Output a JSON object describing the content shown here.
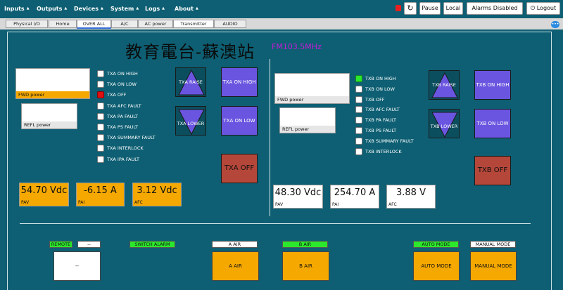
{
  "nav": {
    "items": [
      {
        "label": "Inputs"
      },
      {
        "label": "Outputs"
      },
      {
        "label": "Devices"
      },
      {
        "label": "System"
      },
      {
        "label": "Logs"
      },
      {
        "label": "About"
      }
    ],
    "pause_label": "Pause",
    "local_label": "Local",
    "alarms_label": "Alarms Disabled",
    "logout_label": "Logout",
    "caret_glyph": "▲",
    "refresh_glyph": "↻",
    "logout_glyph": "⏻"
  },
  "tabs": [
    {
      "label": "Physical I/O"
    },
    {
      "label": "Home"
    },
    {
      "label": "OVER ALL",
      "active": true
    },
    {
      "label": "A/C"
    },
    {
      "label": "AC power"
    },
    {
      "label": "Transmitter"
    },
    {
      "label": "AUDIO"
    }
  ],
  "station": {
    "title": "教育電台-蘇澳站",
    "freq": "FM103.5MHz"
  },
  "txa": {
    "fwd_label": "FWD power",
    "refl_label": "REFL power",
    "lamps": [
      {
        "label": "TXA ON HIGH",
        "state": "off"
      },
      {
        "label": "TXA ON LOW",
        "state": "off"
      },
      {
        "label": "TXA OFF",
        "state": "red"
      },
      {
        "label": "TXA AFC FAULT",
        "state": "off"
      },
      {
        "label": "TXA PA FAULT",
        "state": "off"
      },
      {
        "label": "TXA PS FAULT",
        "state": "off"
      },
      {
        "label": "TXA SUMMARY FAULT",
        "state": "off"
      },
      {
        "label": "TXA INTERLOCK",
        "state": "off"
      },
      {
        "label": "TXA IPA FAULT",
        "state": "off"
      }
    ],
    "raise_label": "TXA RAISE",
    "lower_label": "TXA LOWER",
    "on_high_label": "TXA ON HIGH",
    "on_low_label": "TXA ON LOW",
    "off_label": "TXA OFF",
    "pav_value": "54.70 Vdc",
    "pav_label": "PAV",
    "pai_value": "-6.15 A",
    "pai_label": "PAI",
    "afc_value": "3.12 Vdc",
    "afc_label": "AFC"
  },
  "txb": {
    "fwd_label": "FWD power",
    "refl_label": "REFL power",
    "lamps": [
      {
        "label": "TXB ON HIGH",
        "state": "green"
      },
      {
        "label": "TXB ON LOW",
        "state": "off"
      },
      {
        "label": "TXB OFF",
        "state": "off"
      },
      {
        "label": "TXB AFC FAULT",
        "state": "off"
      },
      {
        "label": "TXB PA FAULT",
        "state": "off"
      },
      {
        "label": "TXB PS FAULT",
        "state": "off"
      },
      {
        "label": "TXB SUMMARY FAULT",
        "state": "off"
      },
      {
        "label": "TXB INTERLOCK",
        "state": "off"
      }
    ],
    "raise_label": "TXB RAISE",
    "lower_label": "TXB LOWER",
    "on_high_label": "TXB ON HIGH",
    "on_low_label": "TXB ON LOW",
    "off_label": "TXB OFF",
    "pav_value": "48.30 Vdc",
    "pav_label": "PAV",
    "pai_value": "254.70 A",
    "pai_label": "PAI",
    "afc_value": "3.88 V",
    "afc_label": "AFC"
  },
  "bottom": {
    "remote_label": "REMOTE",
    "dash_label": "--",
    "dash_big_label": "--",
    "switch_alarm_label": "SWITCH ALARM",
    "a_air_tag": "A AIR",
    "a_air_btn": "A AIR",
    "b_air_tag": "B AIR",
    "b_air_btn": "B AIR",
    "auto_tag": "AUTO MODE",
    "auto_btn": "AUTO MODE",
    "manual_tag": "MANUAL MODE",
    "manual_btn": "MANUAL MODE"
  },
  "colors": {
    "background": "#0e5f73",
    "amber": "#f5a800",
    "purple": "#6a55e0",
    "off_red": "#b5473a",
    "lamp_green": "#2ce82c",
    "lamp_red": "#e01010",
    "freq_magenta": "#c21cd6"
  }
}
